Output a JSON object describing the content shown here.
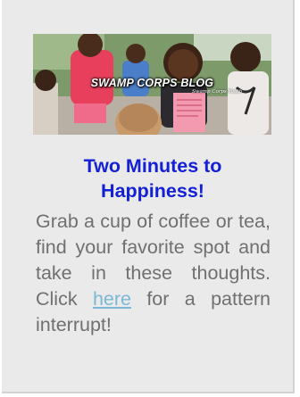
{
  "banner": {
    "title": "SWAMP CORPS BLOG",
    "subtitle": "Swamp Corps Youth"
  },
  "post": {
    "title": "Two Minutes to Happiness!",
    "body_before_link": "Grab a cup of coffee or tea, find your favorite spot and take in these thoughts. Click ",
    "link_text": "here",
    "body_after_link": " for a pattern interrupt!"
  },
  "colors": {
    "widget_bg": "#eaeaea",
    "title": "#1420d6",
    "body_text": "#707070",
    "link": "#7ab8d6"
  }
}
